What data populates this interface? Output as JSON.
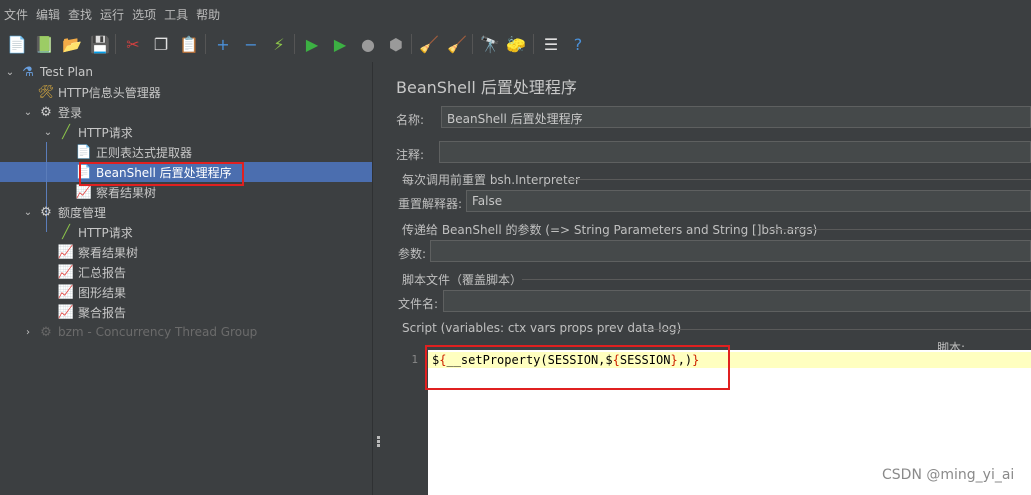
{
  "menu": [
    "文件",
    "编辑",
    "查找",
    "运行",
    "选项",
    "工具",
    "帮助"
  ],
  "toolbar": [
    {
      "name": "new-icon",
      "glyph": "📄",
      "color": "#e8e8e8"
    },
    {
      "name": "templates-icon",
      "glyph": "📗",
      "color": "#4aa84a"
    },
    {
      "name": "open-icon",
      "glyph": "📂",
      "color": "#e0a030"
    },
    {
      "name": "save-icon",
      "glyph": "💾",
      "color": "#c8c8c8"
    },
    {
      "name": "cut-icon",
      "glyph": "✂",
      "color": "#d04040"
    },
    {
      "name": "copy-icon",
      "glyph": "❐",
      "color": "#e0e0e0"
    },
    {
      "name": "paste-icon",
      "glyph": "📋",
      "color": "#d8b060"
    },
    {
      "name": "expand-icon",
      "glyph": "+",
      "color": "#4a90d9"
    },
    {
      "name": "collapse-icon",
      "glyph": "−",
      "color": "#4a90d9"
    },
    {
      "name": "toggle-icon",
      "glyph": "⚡",
      "color": "#8bc34a"
    },
    {
      "name": "start-icon",
      "glyph": "▶",
      "color": "#3cb043"
    },
    {
      "name": "start-no-pause-icon",
      "glyph": "▶",
      "color": "#3cb043"
    },
    {
      "name": "stop-icon",
      "glyph": "●",
      "color": "#9a9a9a"
    },
    {
      "name": "shutdown-icon",
      "glyph": "⬢",
      "color": "#9a9a9a"
    },
    {
      "name": "clear-icon",
      "glyph": "🧹",
      "color": "#d0a060"
    },
    {
      "name": "clear-all-icon",
      "glyph": "🧹",
      "color": "#d0a060"
    },
    {
      "name": "search-icon",
      "glyph": "🔭",
      "color": "#d0d0d0"
    },
    {
      "name": "reset-search-icon",
      "glyph": "🧽",
      "color": "#f0d040"
    },
    {
      "name": "function-helper-icon",
      "glyph": "☰",
      "color": "#e0e0e0"
    },
    {
      "name": "help-icon",
      "glyph": "?",
      "color": "#4a90d9"
    }
  ],
  "tree": [
    {
      "label": "Test Plan",
      "icon": "flask-icon",
      "glyph": "⚗",
      "arrow": "⌄"
    },
    {
      "label": "HTTP信息头管理器",
      "icon": "tools-icon",
      "glyph": "🛠",
      "arrow": ""
    },
    {
      "label": "登录",
      "icon": "thread-group-icon",
      "glyph": "⚙",
      "arrow": "⌄"
    },
    {
      "label": "HTTP请求",
      "icon": "sampler-icon",
      "glyph": "╱",
      "arrow": "⌄"
    },
    {
      "label": "正则表达式提取器",
      "icon": "postprocessor-icon",
      "glyph": "📄",
      "arrow": ""
    },
    {
      "label": "BeanShell 后置处理程序",
      "icon": "postprocessor-icon",
      "glyph": "📄",
      "arrow": ""
    },
    {
      "label": "察看结果树",
      "icon": "listener-icon",
      "glyph": "📈",
      "arrow": ""
    },
    {
      "label": "额度管理",
      "icon": "thread-group-icon",
      "glyph": "⚙",
      "arrow": "⌄"
    },
    {
      "label": "HTTP请求",
      "icon": "sampler-icon",
      "glyph": "╱",
      "arrow": ""
    },
    {
      "label": "察看结果树",
      "icon": "listener-icon",
      "glyph": "📈",
      "arrow": ""
    },
    {
      "label": "汇总报告",
      "icon": "listener-icon",
      "glyph": "📈",
      "arrow": ""
    },
    {
      "label": "图形结果",
      "icon": "listener-icon",
      "glyph": "📈",
      "arrow": ""
    },
    {
      "label": "聚合报告",
      "icon": "listener-icon",
      "glyph": "📈",
      "arrow": ""
    },
    {
      "label": "bzm - Concurrency Thread Group",
      "icon": "thread-group-icon",
      "glyph": "⚙",
      "arrow": "›"
    }
  ],
  "panel": {
    "title": "BeanShell 后置处理程序",
    "name_label": "名称:",
    "name_value": "BeanShell 后置处理程序",
    "comment_label": "注释:",
    "comment_value": "",
    "reset_section": "每次调用前重置 bsh.Interpreter",
    "reset_label": "重置解释器:",
    "reset_value": "False",
    "params_section": "传递给 BeanShell 的参数 (=> String Parameters and String []bsh.args)",
    "params_label": "参数:",
    "params_value": "",
    "file_section": "脚本文件（覆盖脚本）",
    "file_label": "文件名:",
    "file_value": "",
    "script_section": "Script (variables: ctx vars props prev data log)",
    "script_label": "脚本:",
    "line_number": "1",
    "code": {
      "p1": "$",
      "p2": "{",
      "p3": "__setProperty(SESSION,$",
      "p4": "{",
      "p5": "SESSION",
      "p6": "}",
      "p7": ",)",
      "p8": "}"
    }
  },
  "watermark": "CSDN @ming_yi_ai",
  "colors": {
    "selection": "#4b6eaf",
    "highlight_box": "#e02020",
    "editor_current_line": "#ffffc0"
  }
}
